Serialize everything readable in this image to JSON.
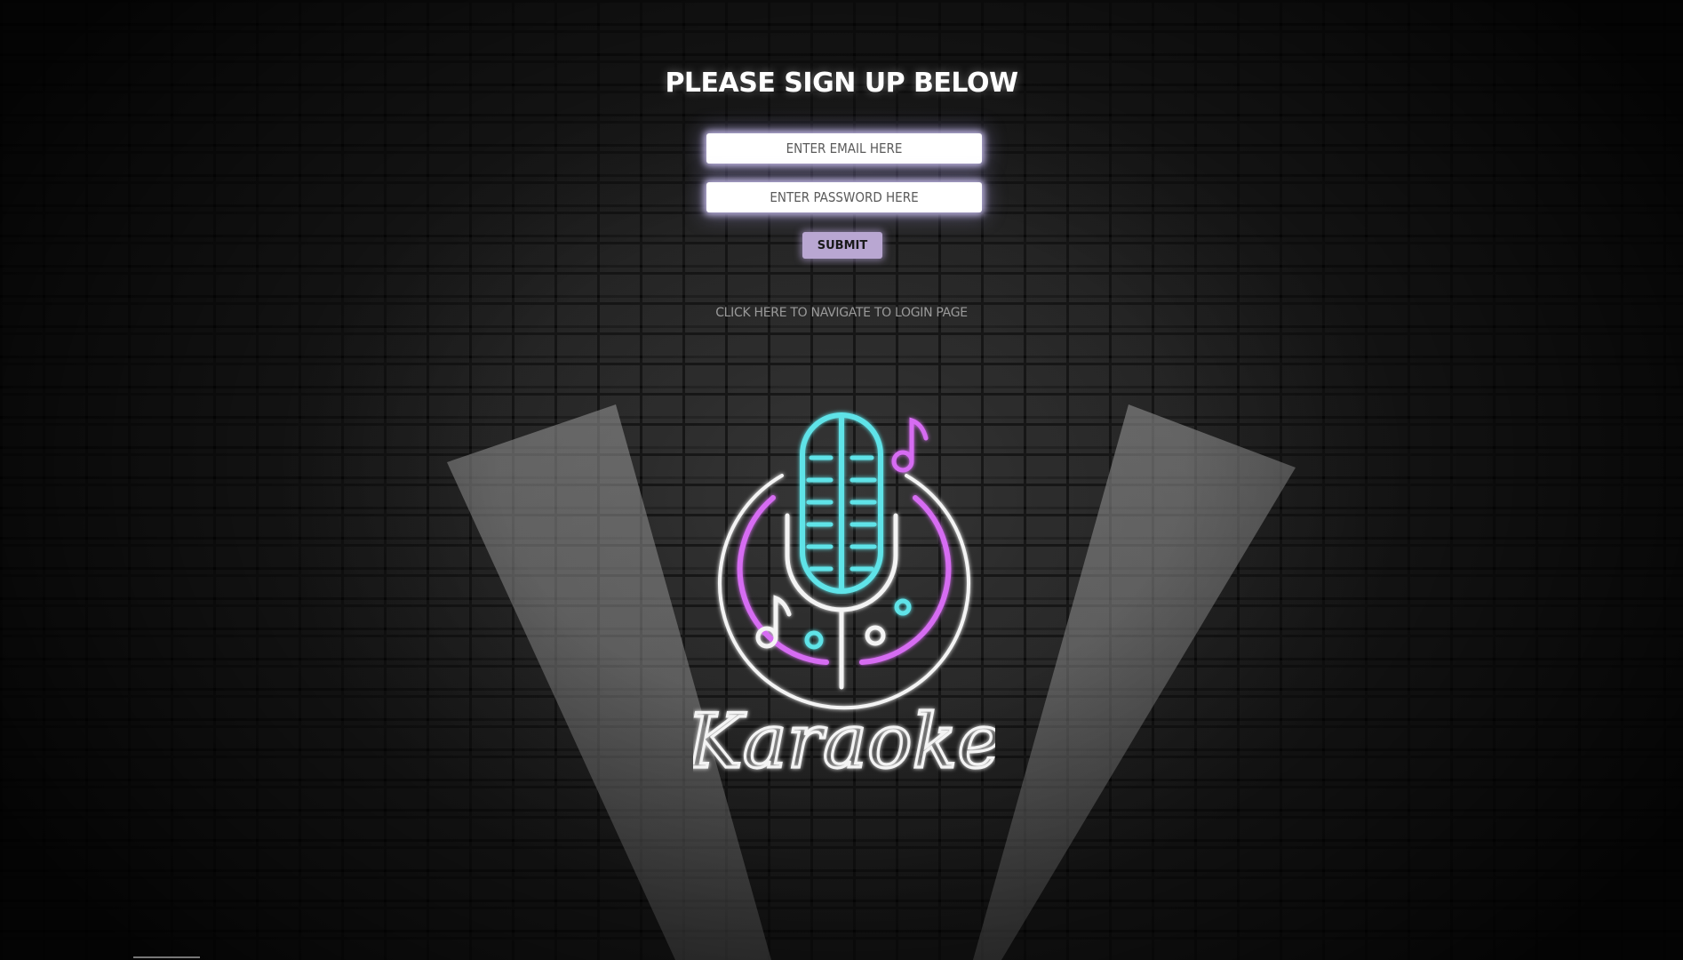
{
  "signup": {
    "title": "PLEASE SIGN UP BELOW",
    "email_placeholder": "ENTER EMAIL HERE",
    "password_placeholder": "ENTER PASSWORD HERE",
    "submit_label": "SUBMIT",
    "login_link": "CLICK HERE TO NAVIGATE TO LOGIN PAGE"
  },
  "logo": {
    "text": "Karaoke",
    "icon": "microphone-neon-icon"
  },
  "colors": {
    "mic_cyan": "#5fe3e8",
    "accent_magenta": "#d66cf2",
    "neon_white": "#f4f4f4",
    "submit_bg": "#b9a7d2"
  }
}
